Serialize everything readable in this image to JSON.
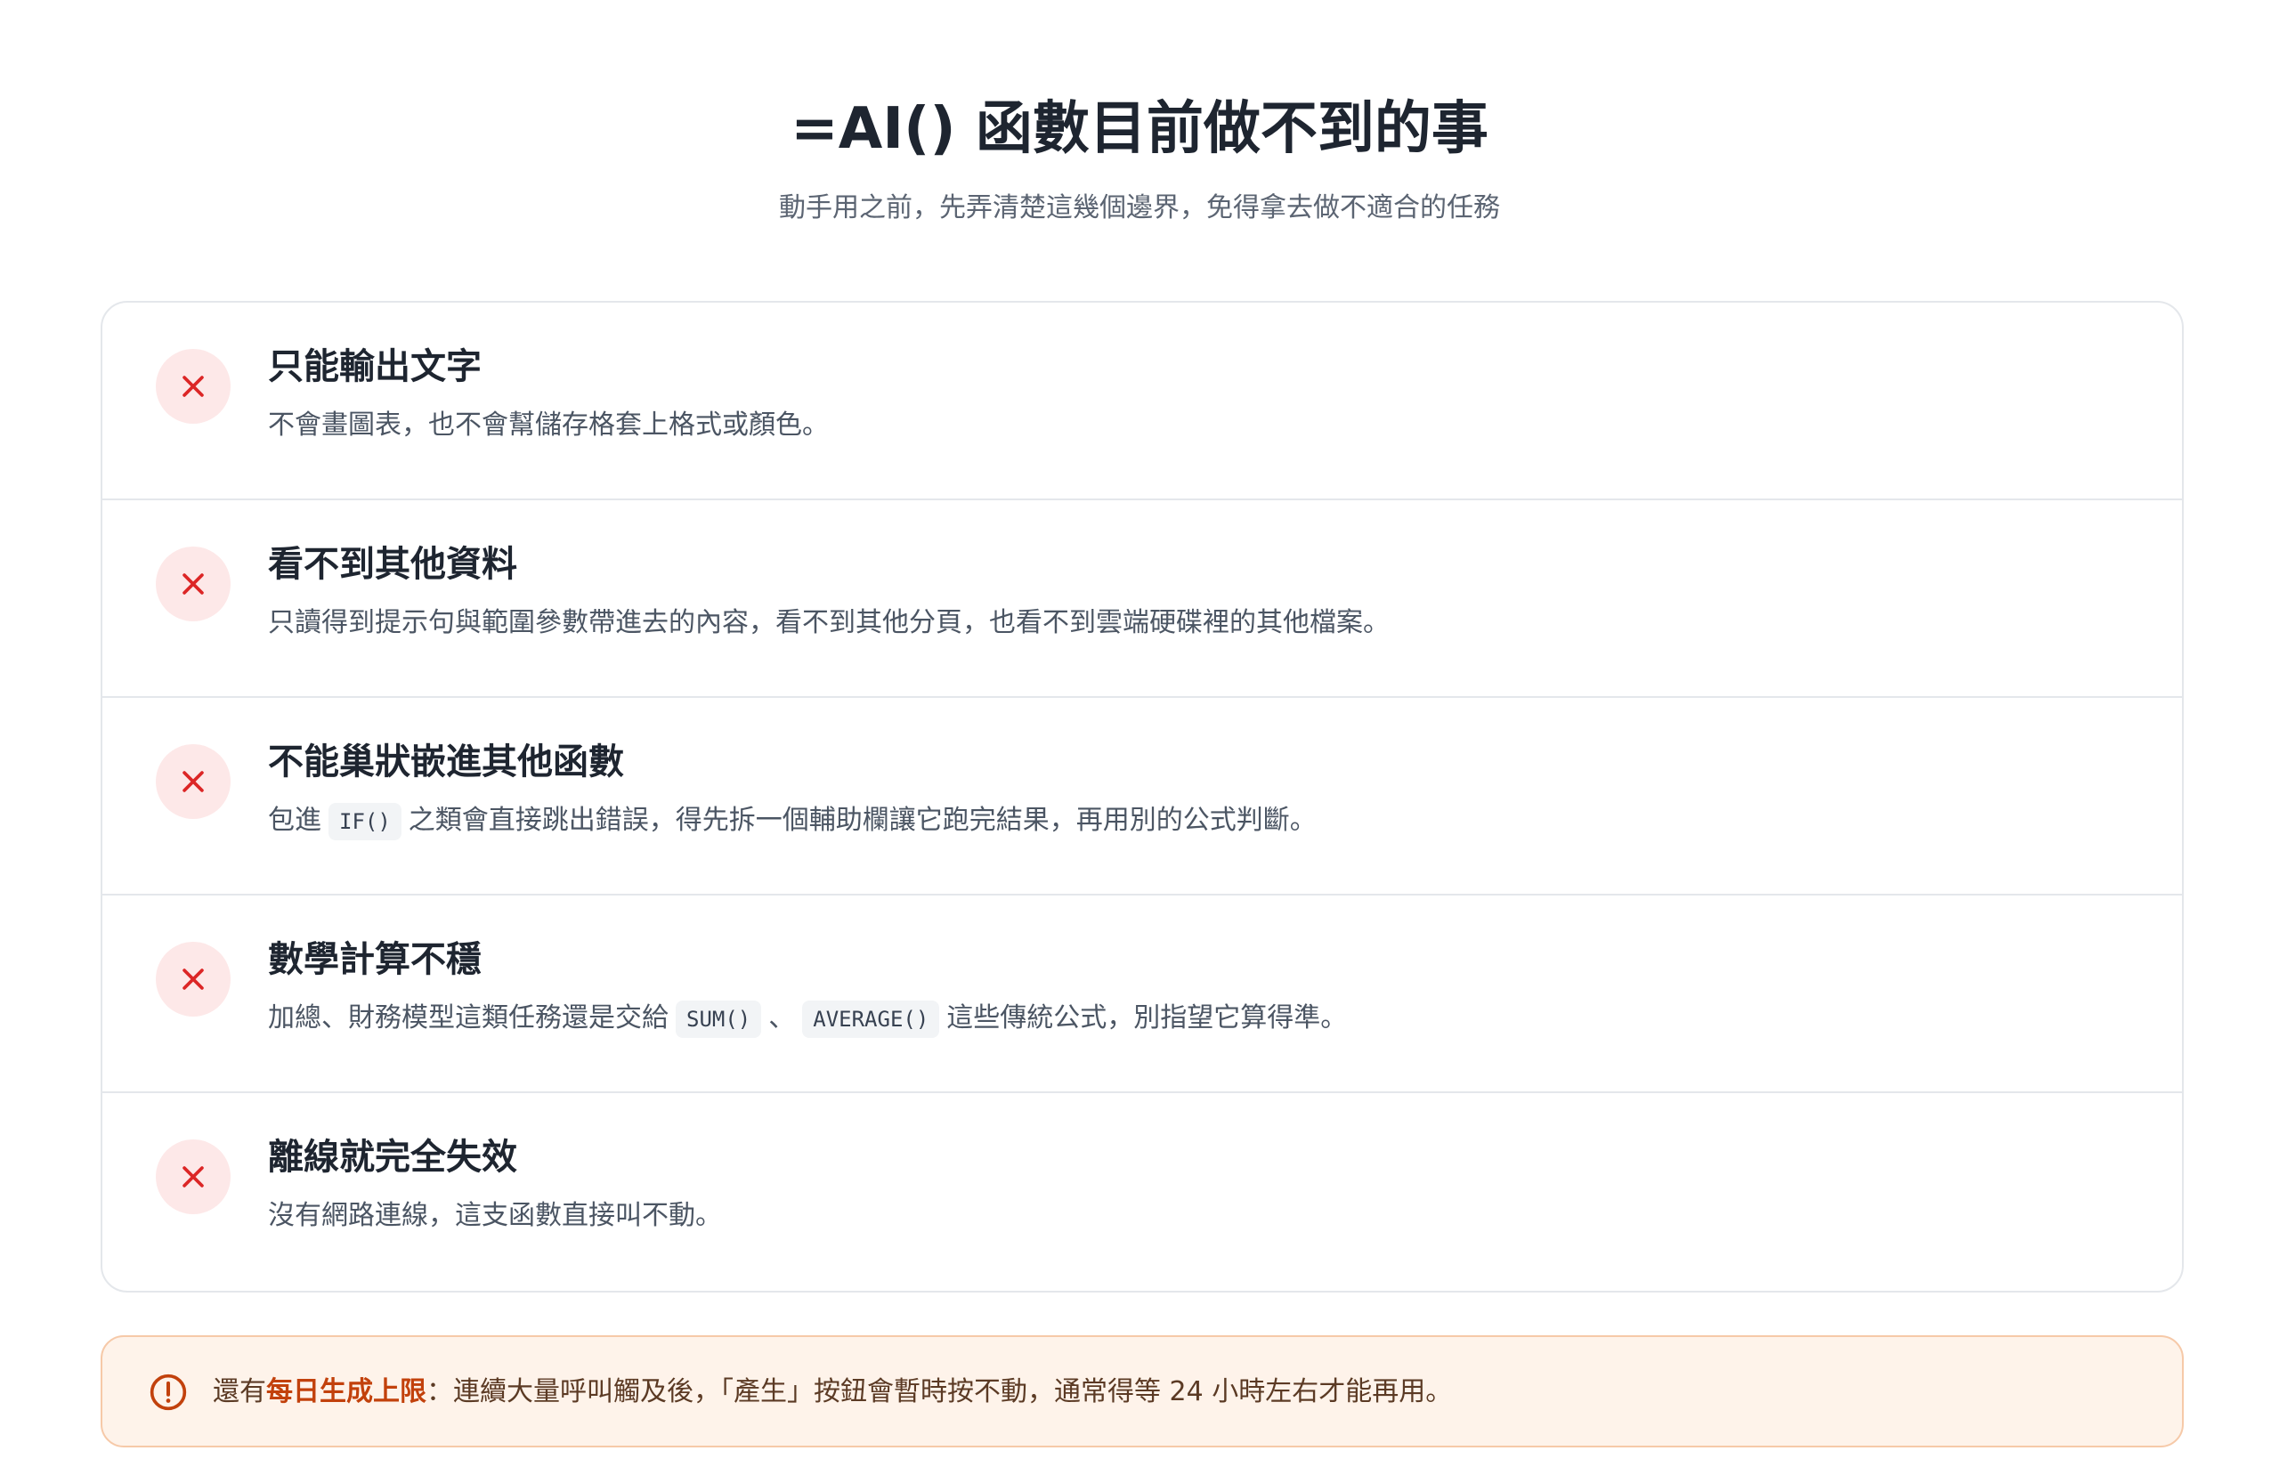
{
  "header": {
    "title": "=AI() 函數目前做不到的事",
    "subtitle": "動手用之前，先弄清楚這幾個邊界，免得拿去做不適合的任務"
  },
  "items": [
    {
      "title": "只能輸出文字",
      "desc": "不會畫圖表，也不會幫儲存格套上格式或顏色。"
    },
    {
      "title": "看不到其他資料",
      "desc": "只讀得到提示句與範圍參數帶進去的內容，看不到其他分頁，也看不到雲端硬碟裡的其他檔案。"
    },
    {
      "title": "不能巢狀嵌進其他函數",
      "desc_before": "包進",
      "code": "IF()",
      "desc_after": "之類會直接跳出錯誤，得先拆一個輔助欄讓它跑完結果，再用別的公式判斷。"
    },
    {
      "title": "數學計算不穩",
      "desc_before": "加總、財務模型這類任務還是交給",
      "code1": "SUM()",
      "separator": "、",
      "code2": "AVERAGE()",
      "desc_after": "這些傳統公式，別指望它算得準。"
    },
    {
      "title": "離線就完全失效",
      "desc": "沒有網路連線，這支函數直接叫不動。"
    }
  ],
  "notice": {
    "prefix": "還有",
    "highlight": "每日生成上限",
    "rest": "：連續大量呼叫觸及後，「產生」按鈕會暫時按不動，通常得等 24 小時左右才能再用。"
  },
  "icons": {
    "item_icon": "close-x-icon",
    "notice_icon": "alert-circle-icon"
  },
  "colors": {
    "x_icon": "#dc2626",
    "x_badge_bg": "#fde8e8",
    "notice_accent": "#c2410c",
    "notice_bg": "#fef3ea"
  }
}
